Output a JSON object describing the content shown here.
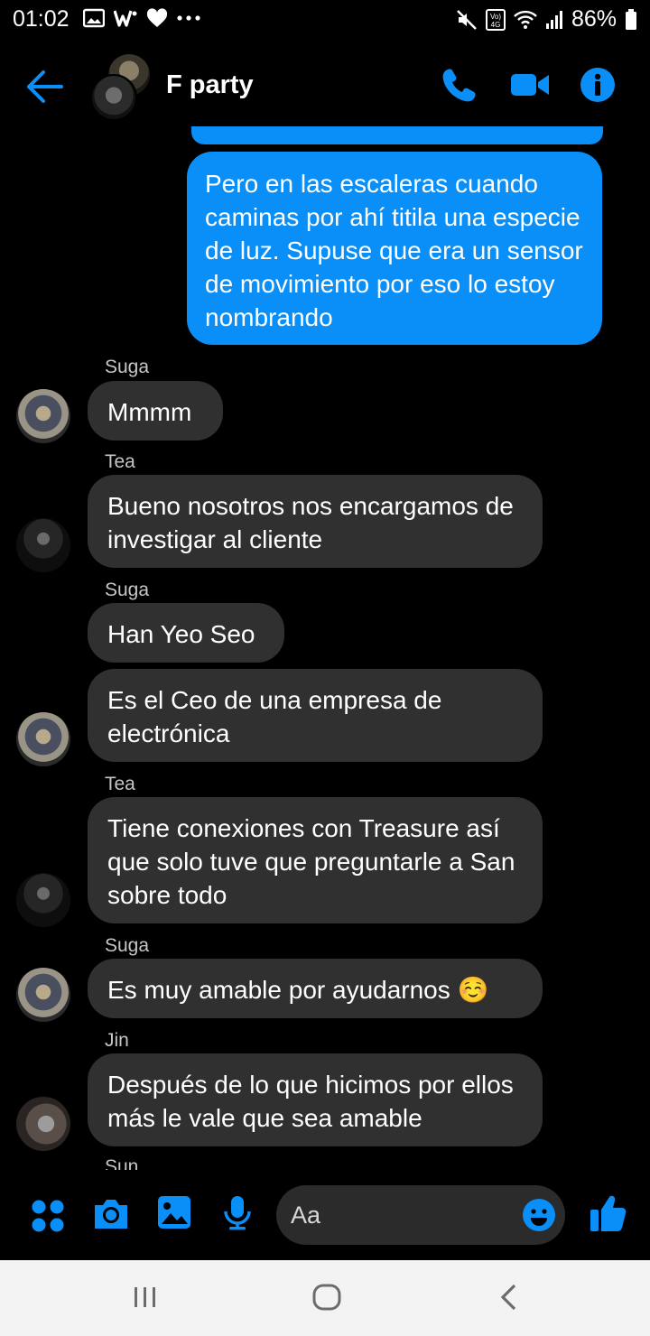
{
  "status_bar": {
    "time": "01:02",
    "signal": "Vo) 4G",
    "battery": "86%"
  },
  "header": {
    "title": "F party"
  },
  "messages": [
    {
      "side": "out",
      "text": "Pero en las escaleras cuando caminas por ahí titila una especie de luz. Supuse que era un sensor de movimiento por eso lo estoy nombrando"
    },
    {
      "side": "in",
      "sender": "Suga",
      "text": "Mmmm"
    },
    {
      "side": "in",
      "sender": "Tea",
      "text": "Bueno nosotros nos encargamos de investigar al cliente"
    },
    {
      "side": "in",
      "sender": "Suga",
      "text": "Han Yeo Seo"
    },
    {
      "side": "in",
      "text": "Es el Ceo de una empresa de electrónica"
    },
    {
      "side": "in",
      "sender": "Tea",
      "text": "Tiene conexiones con Treasure así que solo tuve que preguntarle a San sobre todo"
    },
    {
      "side": "in",
      "sender": "Suga",
      "text": "Es muy amable por ayudarnos ☺️"
    },
    {
      "side": "in",
      "sender": "Jin",
      "text": "Después de lo que hicimos por ellos más le vale que sea amable"
    },
    {
      "side": "in",
      "sender": "Sun",
      "text": ""
    }
  ],
  "composer": {
    "placeholder": "Aa"
  },
  "colors": {
    "accent": "#0a8ff8",
    "incoming_bubble": "#303030",
    "background": "#000000"
  }
}
